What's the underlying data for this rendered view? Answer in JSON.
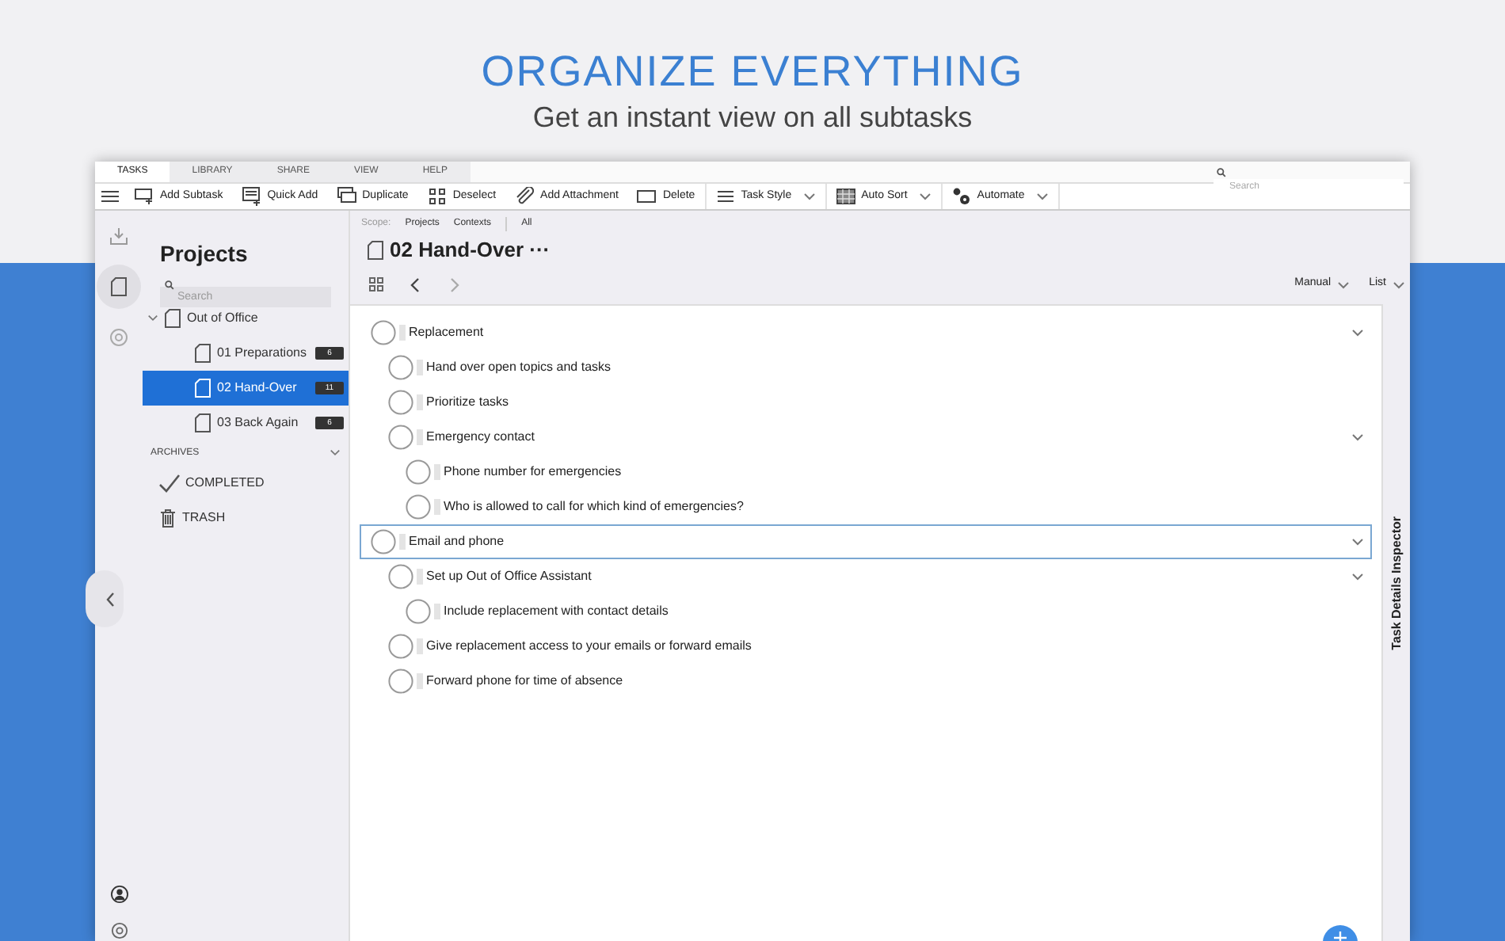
{
  "hero": {
    "title": "ORGANIZE EVERYTHING",
    "subtitle": "Get an instant view on all subtasks"
  },
  "menu_tabs": [
    {
      "label": "TASKS",
      "selected": true
    },
    {
      "label": "LIBRARY",
      "selected": false
    },
    {
      "label": "SHARE",
      "selected": false
    },
    {
      "label": "VIEW",
      "selected": false
    },
    {
      "label": "HELP",
      "selected": false
    }
  ],
  "top_search": {
    "placeholder": "Search"
  },
  "toolbar": [
    {
      "label": "Add Subtask",
      "kind": "subtask",
      "dropdown": false
    },
    {
      "label": "Quick Add",
      "kind": "quickadd",
      "dropdown": false
    },
    {
      "label": "Duplicate",
      "kind": "duplicate",
      "dropdown": false
    },
    {
      "label": "Deselect",
      "kind": "deselect",
      "dropdown": false
    },
    {
      "label": "Add Attachment",
      "kind": "attachment",
      "dropdown": false
    },
    {
      "label": "Delete",
      "kind": "delete",
      "dropdown": false
    },
    {
      "label": "Task Style",
      "kind": "style",
      "dropdown": true
    },
    {
      "label": "Auto Sort",
      "kind": "sort",
      "dropdown": true
    },
    {
      "label": "Automate",
      "kind": "automate",
      "dropdown": true
    }
  ],
  "sidebar": {
    "title": "Projects",
    "search": {
      "placeholder": "Search"
    },
    "tree": [
      {
        "label": "Out of Office",
        "expanded": true,
        "selected": false,
        "children": [
          {
            "label": "01 Preparations",
            "badge": "6",
            "selected": false
          },
          {
            "label": "02 Hand-Over",
            "badge": "11",
            "selected": true
          },
          {
            "label": "03 Back Again",
            "badge": "6",
            "selected": false
          }
        ]
      }
    ],
    "archives": {
      "label": "ARCHIVES",
      "expanded": true,
      "items": [
        {
          "label": "COMPLETED",
          "kind": "completed"
        },
        {
          "label": "TRASH",
          "kind": "trash"
        }
      ]
    }
  },
  "scope": {
    "label": "Scope:",
    "options": [
      "Projects",
      "Contexts",
      "All"
    ]
  },
  "project_title": "02 Hand-Over ···",
  "sort": [
    "Manual",
    "List"
  ],
  "tasks": [
    {
      "title": "Replacement",
      "selected": false,
      "expanded": true,
      "children": [
        {
          "title": "Hand over open topics and tasks",
          "selected": false
        },
        {
          "title": "Prioritize tasks",
          "selected": false
        },
        {
          "title": "Emergency contact",
          "selected": false,
          "expanded": true,
          "children": [
            {
              "title": "Phone number for emergencies",
              "selected": false
            },
            {
              "title": "Who is allowed to call for which kind of emergencies?",
              "selected": false
            }
          ]
        }
      ]
    },
    {
      "title": "Email and phone",
      "selected": true,
      "expanded": true,
      "children": [
        {
          "title": "Set up Out of Office Assistant",
          "selected": false,
          "expanded": true,
          "children": [
            {
              "title": "Include replacement with contact details",
              "selected": false
            }
          ]
        },
        {
          "title": "Give replacement access to your emails or forward emails",
          "selected": false
        },
        {
          "title": "Forward phone for time of absence",
          "selected": false
        }
      ]
    }
  ],
  "inspector": {
    "label": "Task Details Inspector"
  }
}
